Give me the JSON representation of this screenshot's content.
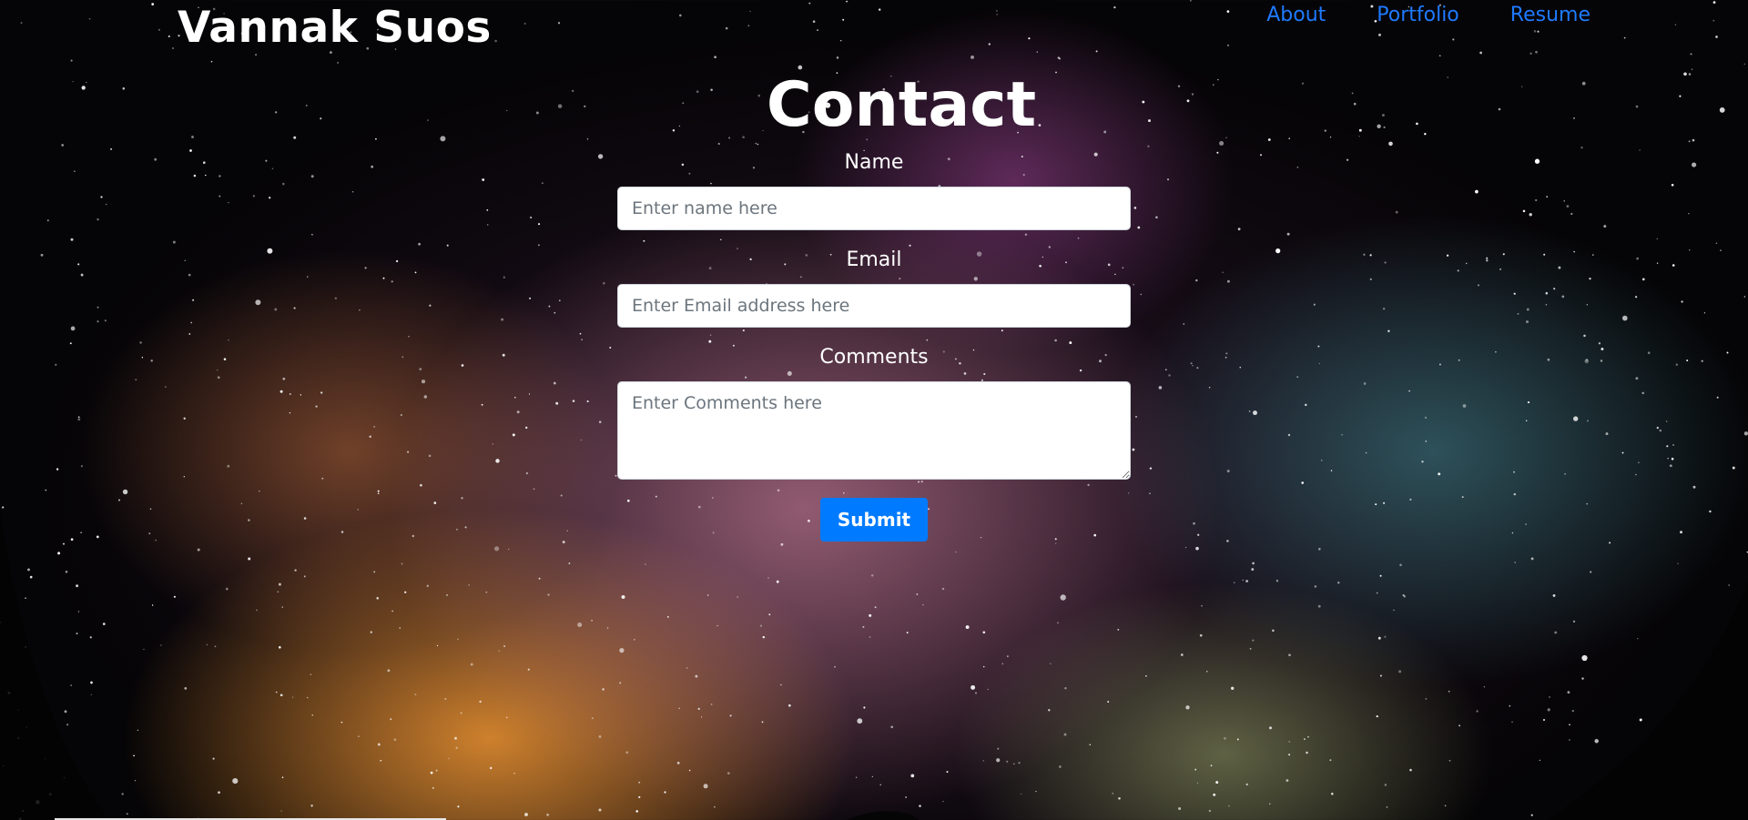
{
  "header": {
    "brand": "Vannak Suos",
    "nav": [
      {
        "label": "About"
      },
      {
        "label": "Portfolio"
      },
      {
        "label": "Resume"
      }
    ],
    "link_color": "#1f7aff"
  },
  "main": {
    "title": "Contact",
    "form": {
      "name": {
        "label": "Name",
        "placeholder": "Enter name here",
        "value": ""
      },
      "email": {
        "label": "Email",
        "placeholder": "Enter Email address here",
        "value": ""
      },
      "comments": {
        "label": "Comments",
        "placeholder": "Enter Comments here",
        "value": ""
      },
      "submit_label": "Submit"
    },
    "button_color": "#007bff"
  },
  "background": {
    "icon": "starry-night-sky-image"
  }
}
